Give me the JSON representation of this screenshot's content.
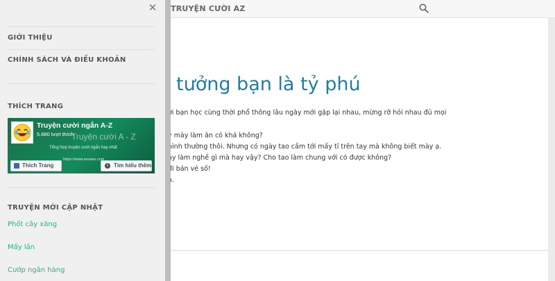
{
  "header": {
    "site_title": "TRUYỆN CƯỜI AZ",
    "search_icon": "search-icon"
  },
  "story": {
    "title": "tưởng bạn là tỷ phú",
    "lines": [
      "ới bạn học cùng thời phổ thông lâu ngày mới gặp lại nhau, mừng rỡ hỏi nhau đủ mọi",
      "y mày làm ăn có khá không?",
      "bình thường thôi. Nhưng có ngày tao cầm tới mấy tỉ trên tay mà không biết mày ạ.",
      "ày làm nghề gì mà hay vậy? Cho tao làm chung với có được không?",
      "đi bán vé số!",
      "a."
    ]
  },
  "drawer": {
    "close_icon": "close-icon",
    "nav": [
      "GIỚI THIỆU",
      "CHÍNH SÁCH VÀ ĐIỀU KHOẢN"
    ],
    "like_section": {
      "heading": "THÍCH TRANG",
      "fb": {
        "page_name": "Truyện cười ngắn A-Z",
        "likes": "5.680 lượt thích",
        "cover_title": "Truyện cười A - Z",
        "cover_tagline": "Tổng hợp truyện cười ngắn hay nhất",
        "cover_url": "https://www.azuaaz.com",
        "like_button": "Thích Trang",
        "learn_button": "Tìm hiểu thêm",
        "avatar_icon": "laughing-emoji-icon"
      }
    },
    "recent": {
      "heading": "TRUYỆN MỚI CẬP NHẬT",
      "items": [
        "Phốt cây xăng",
        "Mấy lần",
        "Cướp ngân hàng"
      ]
    }
  },
  "colors": {
    "title_blue": "#1f7ea8",
    "link_green": "#2bb08a",
    "fb_green": "#138a5b"
  }
}
